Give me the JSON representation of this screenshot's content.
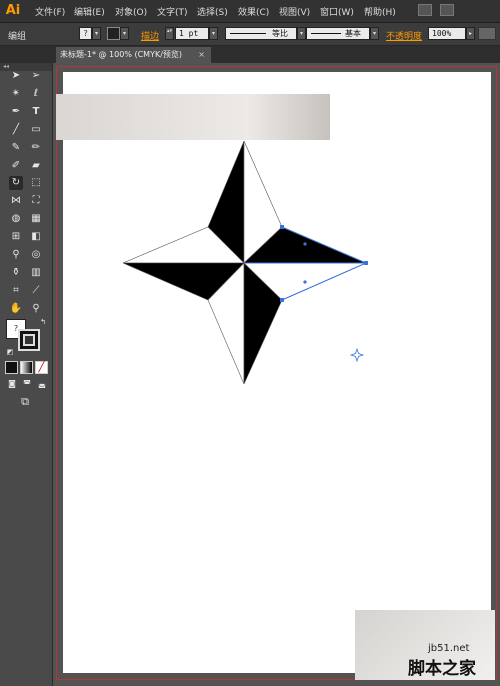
{
  "app": {
    "logo": "Ai"
  },
  "menu": [
    {
      "id": "file",
      "label": "文件(F)"
    },
    {
      "id": "edit",
      "label": "编辑(E)"
    },
    {
      "id": "object",
      "label": "对象(O)"
    },
    {
      "id": "type",
      "label": "文字(T)"
    },
    {
      "id": "select",
      "label": "选择(S)"
    },
    {
      "id": "effect",
      "label": "效果(C)"
    },
    {
      "id": "view",
      "label": "视图(V)"
    },
    {
      "id": "window",
      "label": "窗口(W)"
    },
    {
      "id": "help",
      "label": "帮助(H)"
    }
  ],
  "control": {
    "group_label": "编组",
    "stroke_label": "描边",
    "stroke_weight": "1 pt",
    "profile_uniform": "等比",
    "brush_basic": "基本",
    "opacity_label": "不透明度",
    "opacity_value": "100%"
  },
  "document": {
    "tab_title": "未标题-1* @ 100% (CMYK/预览)",
    "close_glyph": "×"
  },
  "toolbox": {
    "header": "◂◂",
    "fill_glyph": "?"
  },
  "watermark": {
    "site": "jb51.net",
    "name": "脚本之家"
  },
  "colors": {
    "selection": "#3a73d9",
    "artboard_border": "#b33333",
    "accent": "#ff9a00"
  }
}
